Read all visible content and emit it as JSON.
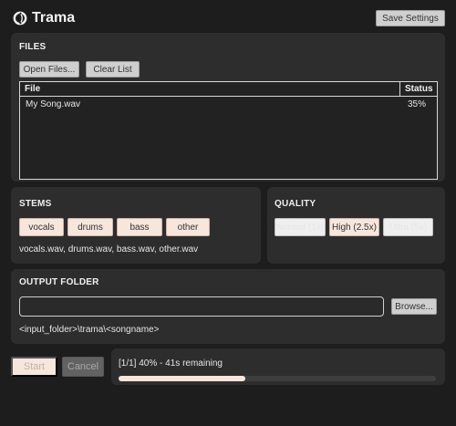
{
  "header": {
    "title": "Trama",
    "logo_icon": "trama-logo-icon",
    "save_settings_label": "Save Settings"
  },
  "files": {
    "title": "FILES",
    "open_label": "Open Files...",
    "clear_label": "Clear List",
    "columns": [
      "File",
      "Status"
    ],
    "rows": [
      {
        "file": "My Song.wav",
        "status": "35%"
      }
    ]
  },
  "stems": {
    "title": "STEMS",
    "chips": [
      "vocals",
      "drums",
      "bass",
      "other"
    ],
    "summary": "vocals.wav, drums.wav, bass.wav, other.wav"
  },
  "quality": {
    "title": "QUALITY",
    "options": [
      "Normal (1x)",
      "High (2.5x)",
      "Ultra (5x)"
    ],
    "selected": "High (2.5x)"
  },
  "output": {
    "title": "OUTPUT FOLDER",
    "path_value": "",
    "browse_label": "Browse...",
    "pattern": "<input_folder>\\trama\\<songname>"
  },
  "actions": {
    "start_label": "Start",
    "cancel_label": "Cancel"
  },
  "progress": {
    "counter": "[1/1]",
    "percent_text": "40%",
    "separator": "-",
    "remaining": "41s remaining",
    "fraction": 0.4
  },
  "colors": {
    "background": "#1d1d1d",
    "panel": "#2d2d2d",
    "accent": "#f7e6dc"
  }
}
